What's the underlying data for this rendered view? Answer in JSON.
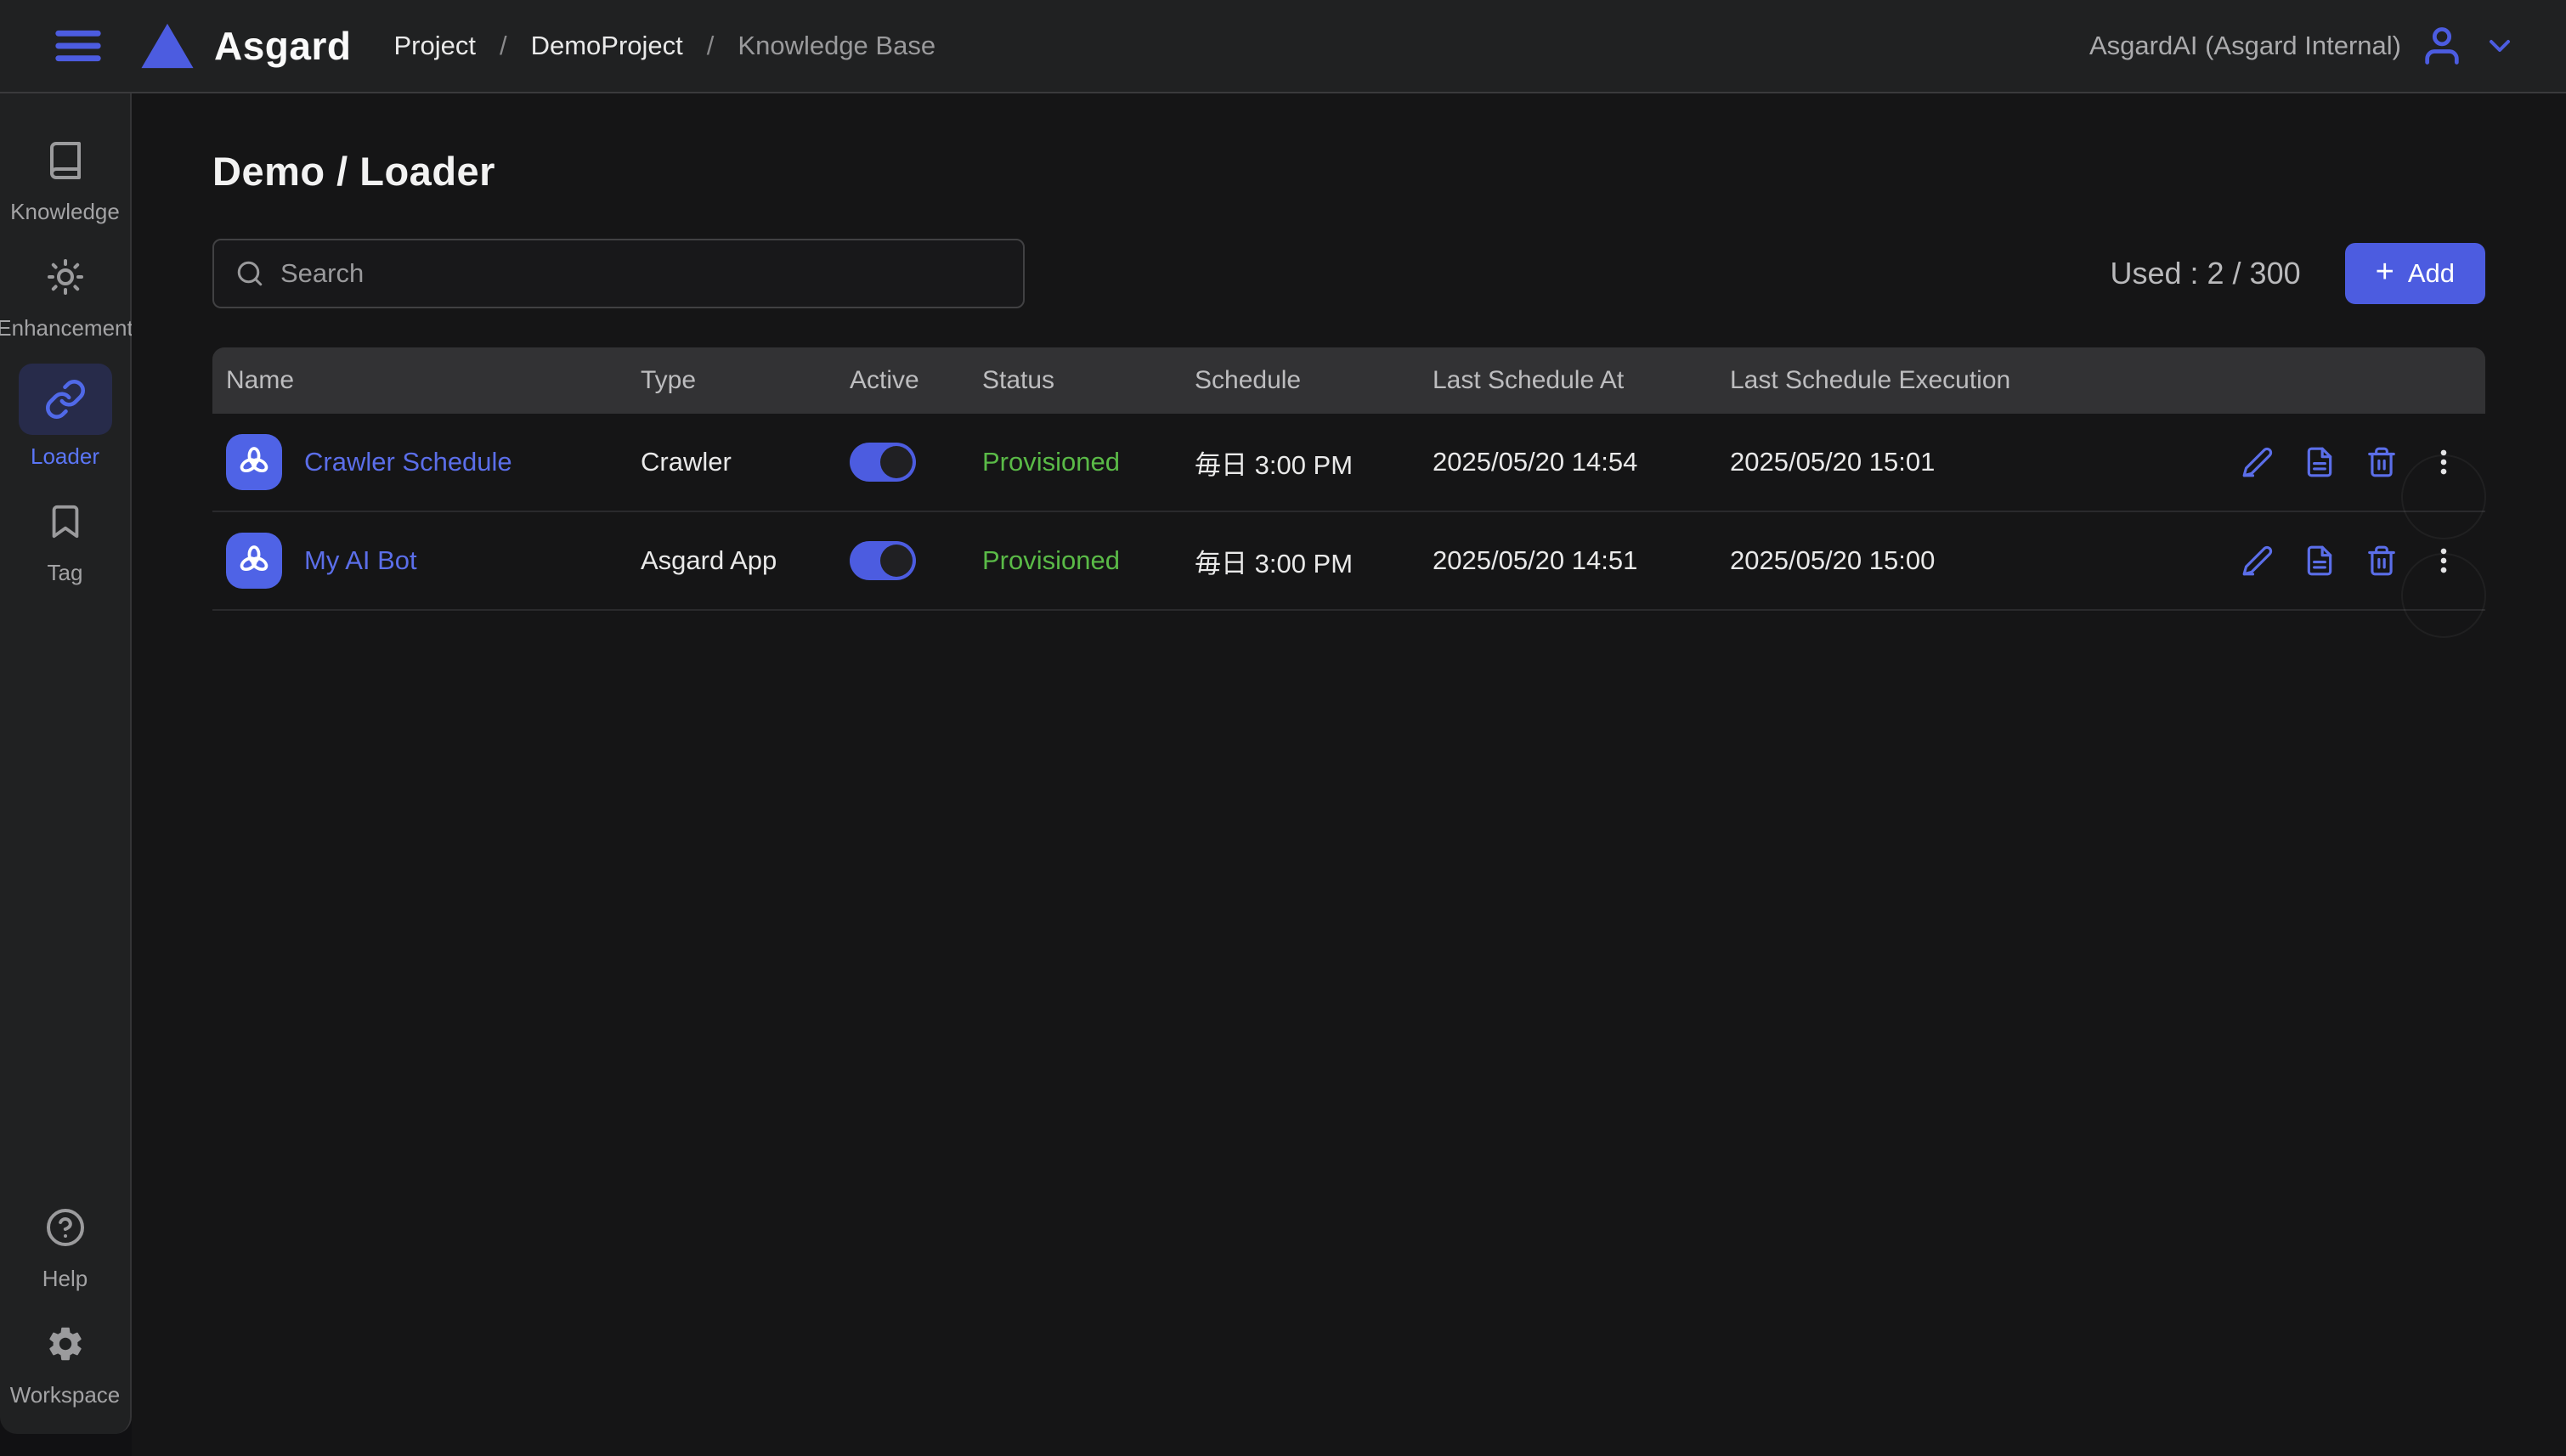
{
  "topbar": {
    "brand": "Asgard",
    "breadcrumb": {
      "separator": "/",
      "items": [
        {
          "label": "Project"
        },
        {
          "label": "DemoProject"
        },
        {
          "label": "Knowledge Base"
        }
      ]
    },
    "account_label": "AsgardAI (Asgard Internal)"
  },
  "sidebar": {
    "items": [
      {
        "label": "Knowledge",
        "icon": "book-icon",
        "active": false
      },
      {
        "label": "Enhancement",
        "icon": "sun-icon",
        "active": false
      },
      {
        "label": "Loader",
        "icon": "link-icon",
        "active": true
      },
      {
        "label": "Tag",
        "icon": "bookmark-icon",
        "active": false
      }
    ],
    "bottom_items": [
      {
        "label": "Help",
        "icon": "help-circle-icon"
      },
      {
        "label": "Workspace",
        "icon": "gear-icon"
      }
    ]
  },
  "main": {
    "title": "Demo / Loader",
    "search": {
      "placeholder": "Search"
    },
    "usage_label": "Used : 2 / 300",
    "add_button": {
      "plus": "+",
      "label": "Add"
    },
    "table": {
      "columns": [
        "Name",
        "Type",
        "Active",
        "Status",
        "Schedule",
        "Last Schedule At",
        "Last Schedule Execution"
      ],
      "rows": [
        {
          "name": "Crawler Schedule",
          "type": "Crawler",
          "active": true,
          "status": "Provisioned",
          "schedule": "毎日 3:00 PM",
          "last_schedule_at": "2025/05/20 14:54",
          "last_schedule_execution": "2025/05/20 15:01"
        },
        {
          "name": "My AI Bot",
          "type": "Asgard App",
          "active": true,
          "status": "Provisioned",
          "schedule": "毎日 3:00 PM",
          "last_schedule_at": "2025/05/20 14:51",
          "last_schedule_execution": "2025/05/20 15:00"
        }
      ]
    }
  },
  "colors": {
    "accent_blue": "#4c5ce0",
    "link_blue": "#5b6ee9",
    "sidebar_active_blue": "#5b76f7",
    "status_green": "#5aba47",
    "topbar_bg": "#202122",
    "sidebar_bg": "#202122",
    "main_bg": "#151516",
    "table_header_bg": "#323234"
  }
}
